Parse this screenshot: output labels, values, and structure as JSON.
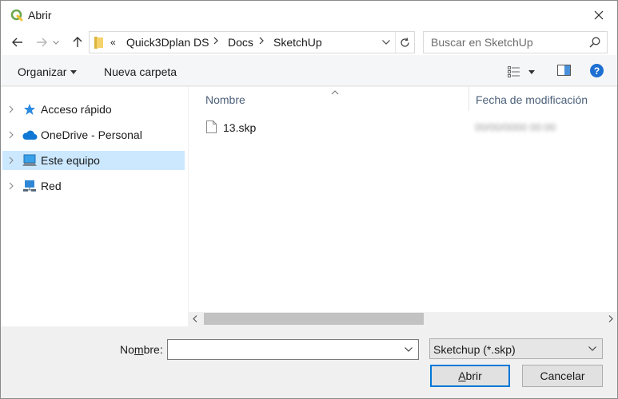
{
  "window": {
    "title": "Abrir",
    "app_icon": "qgis-icon"
  },
  "nav": {
    "back": "arrow-left-icon",
    "forward": "arrow-right-icon",
    "up": "arrow-up-icon",
    "breadcrumb_overflow": "«",
    "breadcrumbs": [
      "Quick3Dplan DS",
      "Docs",
      "SketchUp"
    ]
  },
  "search": {
    "placeholder": "Buscar en SketchUp"
  },
  "toolbar": {
    "organize_label": "Organizar",
    "new_folder_label": "Nueva carpeta",
    "help_label": "?"
  },
  "sidebar": {
    "items": [
      {
        "label": "Acceso rápido",
        "icon": "star-icon"
      },
      {
        "label": "OneDrive - Personal",
        "icon": "cloud-icon"
      },
      {
        "label": "Este equipo",
        "icon": "computer-icon",
        "selected": true
      },
      {
        "label": "Red",
        "icon": "network-icon"
      }
    ]
  },
  "files": {
    "columns": {
      "name": "Nombre",
      "date": "Fecha de modificación"
    },
    "rows": [
      {
        "name": "13.skp",
        "date": "00/00/0000 00:00"
      }
    ]
  },
  "bottom": {
    "filename_label_pre": "No",
    "filename_label_acc": "m",
    "filename_label_post": "bre:",
    "filename_value": "",
    "filetype_value": "Sketchup (*.skp)",
    "open_label_acc": "A",
    "open_label_rest": "brir",
    "cancel_label": "Cancelar"
  },
  "colors": {
    "accent": "#0078d7",
    "selection": "#cce8ff",
    "help": "#1e6fd2"
  }
}
